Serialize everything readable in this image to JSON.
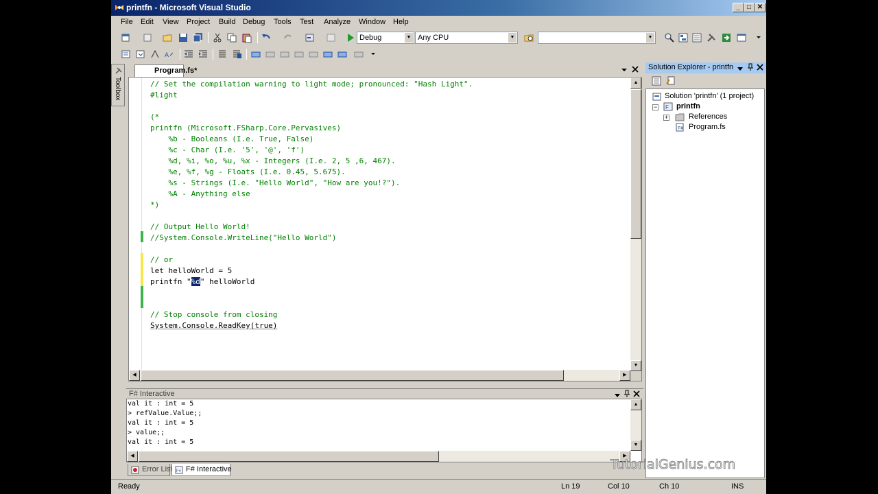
{
  "window": {
    "title": "printfn - Microsoft Visual Studio",
    "buttons": {
      "minimize": "_",
      "maximize": "□",
      "close": "✕"
    }
  },
  "menu": [
    "File",
    "Edit",
    "View",
    "Project",
    "Build",
    "Debug",
    "Tools",
    "Test",
    "Analyze",
    "Window",
    "Help"
  ],
  "toolbar": {
    "config": "Debug",
    "platform": "Any CPU",
    "find": ""
  },
  "toolbox": {
    "label": "Toolbox"
  },
  "editor": {
    "tab": "Program.fs*",
    "lines": [
      {
        "parts": [
          {
            "t": "// Set the compilation warning to light mode; pronounced: \"Hash Light\".",
            "c": "c-comment"
          }
        ]
      },
      {
        "parts": [
          {
            "t": "#light",
            "c": "c-comment"
          }
        ]
      },
      {
        "parts": []
      },
      {
        "parts": [
          {
            "t": "(*",
            "c": "c-comment"
          }
        ]
      },
      {
        "parts": [
          {
            "t": "printfn (Microsoft.FSharp.Core.Pervasives)",
            "c": "c-comment"
          }
        ]
      },
      {
        "parts": [
          {
            "t": "    %b - Booleans (I.e. True, False)",
            "c": "c-comment"
          }
        ]
      },
      {
        "parts": [
          {
            "t": "    %c - Char (I.e. '5', '@', 'f')",
            "c": "c-comment"
          }
        ]
      },
      {
        "parts": [
          {
            "t": "    %d, %i, %o, %u, %x - Integers (I.e. 2, 5 ,6, 467).",
            "c": "c-comment"
          }
        ]
      },
      {
        "parts": [
          {
            "t": "    %e, %f, %g - Floats (I.e. 0.45, 5.675).",
            "c": "c-comment"
          }
        ]
      },
      {
        "parts": [
          {
            "t": "    %s - Strings (I.e. \"Hello World\", \"How are you!?\").",
            "c": "c-comment"
          }
        ]
      },
      {
        "parts": [
          {
            "t": "    %A - Anything else",
            "c": "c-comment"
          }
        ]
      },
      {
        "parts": [
          {
            "t": "*)",
            "c": "c-comment"
          }
        ]
      },
      {
        "parts": []
      },
      {
        "parts": [
          {
            "t": "// Output Hello World!",
            "c": "c-comment"
          }
        ]
      },
      {
        "parts": [
          {
            "t": "//System.Console.WriteLine(\"Hello World\")",
            "c": "c-comment"
          }
        ]
      },
      {
        "parts": []
      },
      {
        "parts": [
          {
            "t": "// or",
            "c": "c-comment"
          }
        ]
      },
      {
        "parts": [
          {
            "t": "let helloWorld = 5",
            "c": "c-plain"
          }
        ]
      },
      {
        "parts": [
          {
            "t": "printfn \"",
            "c": "c-plain"
          },
          {
            "t": "%d",
            "c": "sel"
          },
          {
            "t": "\" helloWorld",
            "c": "c-plain"
          }
        ]
      },
      {
        "parts": []
      },
      {
        "parts": []
      },
      {
        "parts": [
          {
            "t": "// Stop console from closing",
            "c": "c-comment"
          }
        ]
      },
      {
        "parts": [
          {
            "t": "System.Console.ReadKey(true)",
            "c": "c-plain squig"
          }
        ]
      }
    ]
  },
  "solution_explorer": {
    "title": "Solution Explorer - printfn",
    "solution": "Solution 'printfn' (1 project)",
    "project": "printfn",
    "references": "References",
    "file": "Program.fs"
  },
  "fsi": {
    "title": "F# Interactive",
    "lines": [
      "val it : int = 5",
      "> refValue.Value;;",
      "val it : int = 5",
      "> value;;",
      "val it : int = 5",
      "~"
    ],
    "tabs": [
      "Error List",
      "F# Interactive"
    ]
  },
  "status": {
    "state": "Ready",
    "ln": "Ln 19",
    "col": "Col 10",
    "ch": "Ch 10",
    "mode": "INS"
  },
  "watermark": "TutorialGenius.com"
}
